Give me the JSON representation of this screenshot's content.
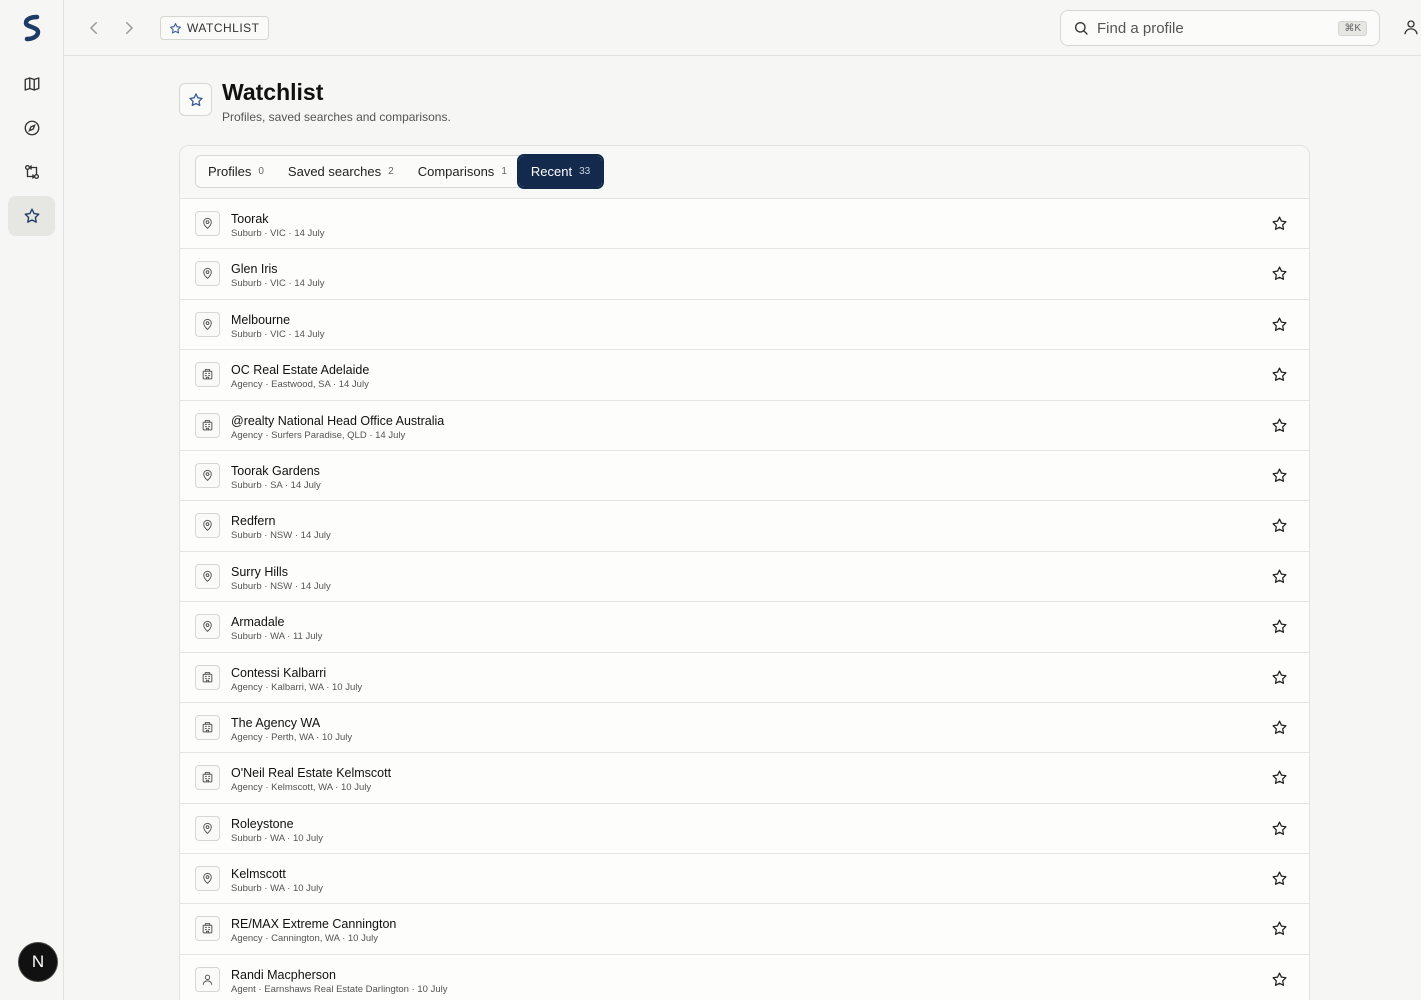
{
  "nav": {
    "items": [
      {
        "name": "map-icon",
        "active": false
      },
      {
        "name": "compass-icon",
        "active": false
      },
      {
        "name": "compare-icon",
        "active": false
      },
      {
        "name": "star-icon",
        "active": true
      }
    ],
    "avatar_letter": "N"
  },
  "topbar": {
    "breadcrumb": "WATCHLIST",
    "search_placeholder": "Find a profile",
    "search_shortcut": "⌘K"
  },
  "header": {
    "title": "Watchlist",
    "subtitle": "Profiles, saved searches and comparisons."
  },
  "tabs": [
    {
      "label": "Profiles",
      "count": "0",
      "active": false
    },
    {
      "label": "Saved searches",
      "count": "2",
      "active": false
    },
    {
      "label": "Comparisons",
      "count": "1",
      "active": false
    },
    {
      "label": "Recent",
      "count": "33",
      "active": true
    }
  ],
  "rows": [
    {
      "icon": "pin-icon",
      "title": "Toorak",
      "sub": "Suburb · VIC · 14 July"
    },
    {
      "icon": "pin-icon",
      "title": "Glen Iris",
      "sub": "Suburb · VIC · 14 July"
    },
    {
      "icon": "pin-icon",
      "title": "Melbourne",
      "sub": "Suburb · VIC · 14 July"
    },
    {
      "icon": "building-icon",
      "title": "OC Real Estate Adelaide",
      "sub": "Agency · Eastwood, SA · 14 July"
    },
    {
      "icon": "building-icon",
      "title": "@realty National Head Office Australia",
      "sub": "Agency · Surfers Paradise, QLD · 14 July"
    },
    {
      "icon": "pin-icon",
      "title": "Toorak Gardens",
      "sub": "Suburb · SA · 14 July"
    },
    {
      "icon": "pin-icon",
      "title": "Redfern",
      "sub": "Suburb · NSW · 14 July"
    },
    {
      "icon": "pin-icon",
      "title": "Surry Hills",
      "sub": "Suburb · NSW · 14 July"
    },
    {
      "icon": "pin-icon",
      "title": "Armadale",
      "sub": "Suburb · WA · 11 July"
    },
    {
      "icon": "building-icon",
      "title": "Contessi Kalbarri",
      "sub": "Agency · Kalbarri, WA · 10 July"
    },
    {
      "icon": "building-icon",
      "title": "The Agency WA",
      "sub": "Agency · Perth, WA · 10 July"
    },
    {
      "icon": "building-icon",
      "title": "O'Neil Real Estate Kelmscott",
      "sub": "Agency · Kelmscott, WA · 10 July"
    },
    {
      "icon": "pin-icon",
      "title": "Roleystone",
      "sub": "Suburb · WA · 10 July"
    },
    {
      "icon": "pin-icon",
      "title": "Kelmscott",
      "sub": "Suburb · WA · 10 July"
    },
    {
      "icon": "building-icon",
      "title": "RE/MAX Extreme Cannington",
      "sub": "Agency · Cannington, WA · 10 July"
    },
    {
      "icon": "person-icon",
      "title": "Randi Macpherson",
      "sub": "Agent · Earnshaws Real Estate Darlington · 10 July"
    }
  ],
  "colors": {
    "accent": "#132a4d",
    "background": "#f6f6f4"
  }
}
